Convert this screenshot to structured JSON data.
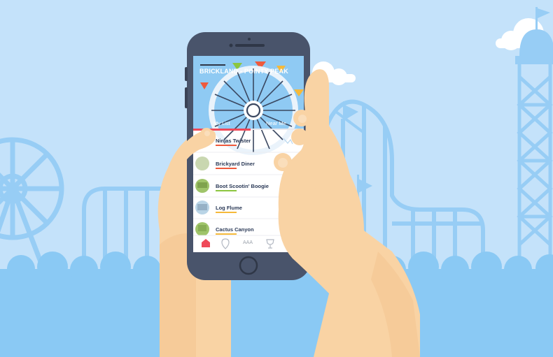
{
  "app": {
    "title": "BRICKLAND - POINTY PEAK",
    "tabs": [
      {
        "label": "My List",
        "active": true
      },
      {
        "label": "Near Me",
        "active": false
      }
    ],
    "rides": [
      {
        "name": "Ninjas Twister",
        "accent": "#ef5a3c"
      },
      {
        "name": "Brickyard Diner",
        "accent": "#ef5a3c"
      },
      {
        "name": "Boot Scootin' Boogie",
        "accent": "#8cc63f"
      },
      {
        "name": "Log Flume",
        "accent": "#f5b93a"
      },
      {
        "name": "Cactus Canyon",
        "accent": "#f5b93a"
      }
    ],
    "bottom_nav": {
      "home_icon": "home-icon",
      "map_pin_icon": "map-pin-icon",
      "aaa_label": "AAA",
      "trophy_icon": "trophy-icon"
    }
  },
  "colors": {
    "sky": "#c4e2fa",
    "ground": "#8ac9f4",
    "structure": "#97cdf5",
    "phone_body": "#49546b",
    "screen_header": "#8fcaf3",
    "accent_red": "#ef4a5a",
    "skin": "#f9d3a4",
    "skin_shadow": "#f2bd86"
  }
}
